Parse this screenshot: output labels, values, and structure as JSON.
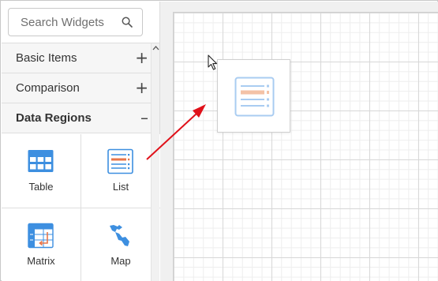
{
  "search": {
    "placeholder": "Search Widgets",
    "icon": "search-icon"
  },
  "categories": [
    {
      "label": "Basic Items",
      "toggle": "+",
      "expanded": false
    },
    {
      "label": "Comparison",
      "toggle": "+",
      "expanded": false
    },
    {
      "label": "Data Regions",
      "toggle": "–",
      "expanded": true
    }
  ],
  "widgets": [
    {
      "label": "Table",
      "icon": "table-icon"
    },
    {
      "label": "List",
      "icon": "list-icon"
    },
    {
      "label": "Matrix",
      "icon": "matrix-icon"
    },
    {
      "label": "Map",
      "icon": "map-icon"
    }
  ],
  "drag_ghost": {
    "icon": "list-icon"
  },
  "colors": {
    "accent_blue": "#3d8fe0",
    "list_orange": "#e8764a",
    "ghost_blue": "#a9ccf1",
    "ghost_orange": "#f4c2a6",
    "arrow_red": "#e0111a",
    "canvas_bg": "#f0f0f0"
  }
}
